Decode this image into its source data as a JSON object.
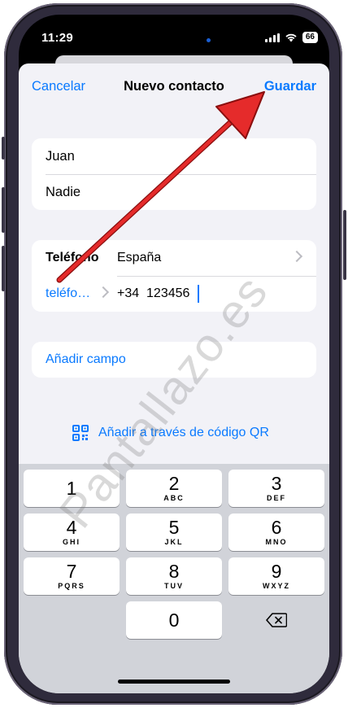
{
  "status_bar": {
    "time": "11:29",
    "battery": "66"
  },
  "nav": {
    "cancel": "Cancelar",
    "title": "Nuevo contacto",
    "save": "Guardar"
  },
  "name_fields": {
    "first_name": "Juan",
    "last_name": "Nadie"
  },
  "phone_section": {
    "label": "Teléfono",
    "country": "España",
    "type_label": "teléfo…",
    "number": "+34  123456"
  },
  "add_field": "Añadir campo",
  "qr_action": "Añadir a través de código QR",
  "keypad": {
    "keys": [
      {
        "num": "1",
        "letters": ""
      },
      {
        "num": "2",
        "letters": "ABC"
      },
      {
        "num": "3",
        "letters": "DEF"
      },
      {
        "num": "4",
        "letters": "GHI"
      },
      {
        "num": "5",
        "letters": "JKL"
      },
      {
        "num": "6",
        "letters": "MNO"
      },
      {
        "num": "7",
        "letters": "PQRS"
      },
      {
        "num": "8",
        "letters": "TUV"
      },
      {
        "num": "9",
        "letters": "WXYZ"
      },
      {
        "num": "0",
        "letters": ""
      }
    ]
  },
  "annotation": {
    "arrow_color": "#e52b2b",
    "watermark": "Pantallazo.es"
  },
  "colors": {
    "accent": "#0a7aff",
    "background": "#f2f2f7"
  }
}
